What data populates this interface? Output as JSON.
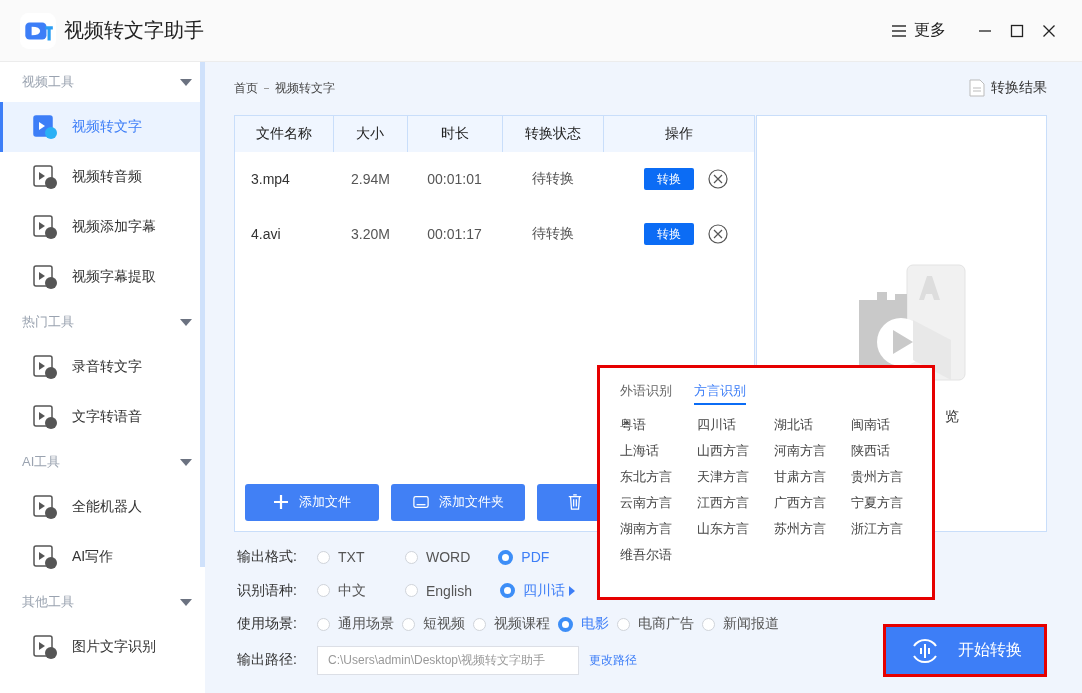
{
  "window": {
    "title": "视频转文字助手",
    "menu_label": "更多"
  },
  "sidebar": {
    "groups": [
      {
        "label": "视频工具",
        "expanded": true,
        "items": [
          {
            "label": "视频转文字",
            "selected": true
          },
          {
            "label": "视频转音频",
            "selected": false
          },
          {
            "label": "视频添加字幕",
            "selected": false
          },
          {
            "label": "视频字幕提取",
            "selected": false
          }
        ]
      },
      {
        "label": "热门工具",
        "expanded": true,
        "items": [
          {
            "label": "录音转文字",
            "selected": false
          },
          {
            "label": "文字转语音",
            "selected": false
          }
        ]
      },
      {
        "label": "AI工具",
        "expanded": true,
        "items": [
          {
            "label": "全能机器人",
            "selected": false
          },
          {
            "label": "AI写作",
            "selected": false
          }
        ]
      },
      {
        "label": "其他工具",
        "expanded": true,
        "items": [
          {
            "label": "图片文字识别",
            "selected": false
          }
        ]
      }
    ]
  },
  "breadcrumb": [
    "首页",
    "视频转文字"
  ],
  "results_link": "转换结果",
  "table": {
    "columns": [
      "文件名称",
      "大小",
      "时长",
      "转换状态",
      "操作"
    ],
    "rows": [
      {
        "name": "3.mp4",
        "size": "2.94M",
        "duration": "00:01:01",
        "status": "待转换",
        "action": "转换"
      },
      {
        "name": "4.avi",
        "size": "3.20M",
        "duration": "00:01:17",
        "status": "待转换",
        "action": "转换"
      }
    ]
  },
  "file_buttons": [
    {
      "kind": "add",
      "label": "添加文件"
    },
    {
      "kind": "folder",
      "label": "添加文件夹"
    },
    {
      "kind": "trash"
    }
  ],
  "preview": {
    "label": "览"
  },
  "options": [
    {
      "label": "输出格式:",
      "choices": [
        {
          "label": "TXT",
          "selected": false
        },
        {
          "label": "WORD",
          "selected": false
        },
        {
          "label": "PDF",
          "selected": true
        }
      ]
    },
    {
      "label": "识别语种:",
      "choices": [
        {
          "label": "中文",
          "selected": false
        },
        {
          "label": "English",
          "selected": false
        },
        {
          "label": "四川话",
          "selected": true,
          "has_menu": true
        }
      ]
    },
    {
      "label": "使用场景:",
      "choices": [
        {
          "label": "通用场景",
          "selected": false
        },
        {
          "label": "短视频",
          "selected": false
        },
        {
          "label": "视频课程",
          "selected": false
        },
        {
          "label": "电影",
          "selected": true
        },
        {
          "label": "电商广告",
          "selected": false
        },
        {
          "label": "新闻报道",
          "selected": false
        }
      ]
    }
  ],
  "output_path": {
    "label": "输出路径:",
    "value": "C:\\Users\\admin\\Desktop\\视频转文字助手",
    "change_link": "更改路径"
  },
  "start_button": {
    "label": "开始转换",
    "annotated": true
  },
  "language_popup": {
    "annotated": true,
    "tabs": [
      {
        "label": "外语识别",
        "selected": false
      },
      {
        "label": "方言识别",
        "selected": true
      }
    ],
    "dialects": [
      "粤语",
      "四川话",
      "湖北话",
      "闽南话",
      "上海话",
      "山西方言",
      "河南方言",
      "陕西话",
      "东北方言",
      "天津方言",
      "甘肃方言",
      "贵州方言",
      "云南方言",
      "江西方言",
      "广西方言",
      "宁夏方言",
      "湖南方言",
      "山东方言",
      "苏州方言",
      "浙江方言",
      "维吾尔语"
    ]
  }
}
